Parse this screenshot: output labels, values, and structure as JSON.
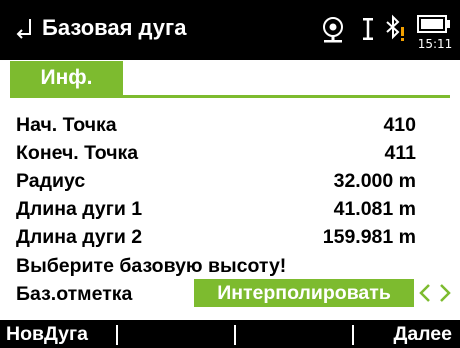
{
  "header": {
    "title": "Базовая дуга",
    "back_icon": "back-arrow-icon",
    "status": {
      "target_icon": "reflector-target-icon",
      "ibeam_icon": "text-cursor-icon",
      "bluetooth_icon": "bluetooth-warning-icon",
      "battery_icon": "battery-icon",
      "time": "15:11"
    }
  },
  "tabs": [
    {
      "label": "Инф.",
      "active": true
    }
  ],
  "fields": [
    {
      "label": "Нач. Точка",
      "value": "410"
    },
    {
      "label": "Конеч. Точка",
      "value": "411"
    },
    {
      "label": "Радиус",
      "value": "32.000 m"
    },
    {
      "label": "Длина дуги 1",
      "value": "41.081 m"
    },
    {
      "label": "Длина дуги 2",
      "value": "159.981 m"
    }
  ],
  "message": "Выберите базовую высоту!",
  "height_choice": {
    "label": "Баз.отметка",
    "value": "Интерполировать",
    "prev_icon": "chevron-left-icon",
    "next_icon": "chevron-right-icon"
  },
  "softkeys": {
    "f1": "НовДуга",
    "f2": "",
    "f3": "",
    "f4": "Далее"
  },
  "colors": {
    "accent": "#7dbb2f",
    "bar": "#000000",
    "background": "#ffffff",
    "warning": "#f2a000"
  }
}
